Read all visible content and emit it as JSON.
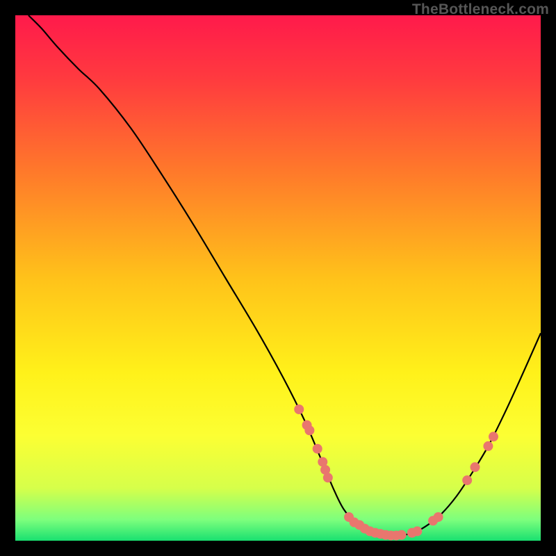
{
  "watermark": "TheBottleneck.com",
  "chart_data": {
    "type": "line",
    "title": "",
    "xlabel": "",
    "ylabel": "",
    "xlim": [
      0,
      100
    ],
    "ylim": [
      0,
      100
    ],
    "background_gradient": {
      "stops": [
        {
          "offset": 0.0,
          "color": "#ff1a4b"
        },
        {
          "offset": 0.12,
          "color": "#ff3a3f"
        },
        {
          "offset": 0.3,
          "color": "#ff7a2a"
        },
        {
          "offset": 0.5,
          "color": "#ffc21a"
        },
        {
          "offset": 0.68,
          "color": "#fff11a"
        },
        {
          "offset": 0.8,
          "color": "#fcff33"
        },
        {
          "offset": 0.9,
          "color": "#d6ff4a"
        },
        {
          "offset": 0.96,
          "color": "#7dff7d"
        },
        {
          "offset": 1.0,
          "color": "#19e070"
        }
      ]
    },
    "curve": [
      {
        "x": 2.5,
        "y": 100.0
      },
      {
        "x": 5.0,
        "y": 97.5
      },
      {
        "x": 8.0,
        "y": 94.0
      },
      {
        "x": 12.0,
        "y": 89.8
      },
      {
        "x": 16.0,
        "y": 86.0
      },
      {
        "x": 22.0,
        "y": 78.5
      },
      {
        "x": 28.0,
        "y": 69.5
      },
      {
        "x": 34.0,
        "y": 60.0
      },
      {
        "x": 40.0,
        "y": 50.0
      },
      {
        "x": 46.0,
        "y": 40.0
      },
      {
        "x": 51.0,
        "y": 31.0
      },
      {
        "x": 55.0,
        "y": 23.0
      },
      {
        "x": 58.0,
        "y": 16.0
      },
      {
        "x": 60.5,
        "y": 10.0
      },
      {
        "x": 62.5,
        "y": 6.0
      },
      {
        "x": 65.0,
        "y": 3.2
      },
      {
        "x": 67.5,
        "y": 1.8
      },
      {
        "x": 70.0,
        "y": 1.2
      },
      {
        "x": 73.0,
        "y": 1.0
      },
      {
        "x": 76.0,
        "y": 1.6
      },
      {
        "x": 78.5,
        "y": 3.0
      },
      {
        "x": 81.0,
        "y": 5.0
      },
      {
        "x": 84.0,
        "y": 8.5
      },
      {
        "x": 87.0,
        "y": 13.0
      },
      {
        "x": 90.0,
        "y": 18.0
      },
      {
        "x": 93.0,
        "y": 24.0
      },
      {
        "x": 96.0,
        "y": 30.5
      },
      {
        "x": 100.0,
        "y": 39.5
      }
    ],
    "markers": [
      {
        "x": 54.0,
        "y": 25.0
      },
      {
        "x": 55.5,
        "y": 22.0
      },
      {
        "x": 56.0,
        "y": 21.0
      },
      {
        "x": 57.5,
        "y": 17.5
      },
      {
        "x": 58.5,
        "y": 15.0
      },
      {
        "x": 59.0,
        "y": 13.5
      },
      {
        "x": 59.5,
        "y": 12.0
      },
      {
        "x": 63.5,
        "y": 4.5
      },
      {
        "x": 64.5,
        "y": 3.5
      },
      {
        "x": 65.5,
        "y": 3.0
      },
      {
        "x": 66.5,
        "y": 2.3
      },
      {
        "x": 67.5,
        "y": 1.8
      },
      {
        "x": 68.5,
        "y": 1.5
      },
      {
        "x": 69.5,
        "y": 1.3
      },
      {
        "x": 70.5,
        "y": 1.1
      },
      {
        "x": 71.5,
        "y": 1.0
      },
      {
        "x": 72.5,
        "y": 1.0
      },
      {
        "x": 73.5,
        "y": 1.1
      },
      {
        "x": 75.5,
        "y": 1.5
      },
      {
        "x": 76.5,
        "y": 1.8
      },
      {
        "x": 79.5,
        "y": 3.8
      },
      {
        "x": 80.5,
        "y": 4.5
      },
      {
        "x": 86.0,
        "y": 11.5
      },
      {
        "x": 87.5,
        "y": 14.0
      },
      {
        "x": 90.0,
        "y": 18.0
      },
      {
        "x": 91.0,
        "y": 19.8
      }
    ],
    "curve_color": "#000000",
    "marker_color": "#e9766e",
    "marker_radius": 7
  }
}
